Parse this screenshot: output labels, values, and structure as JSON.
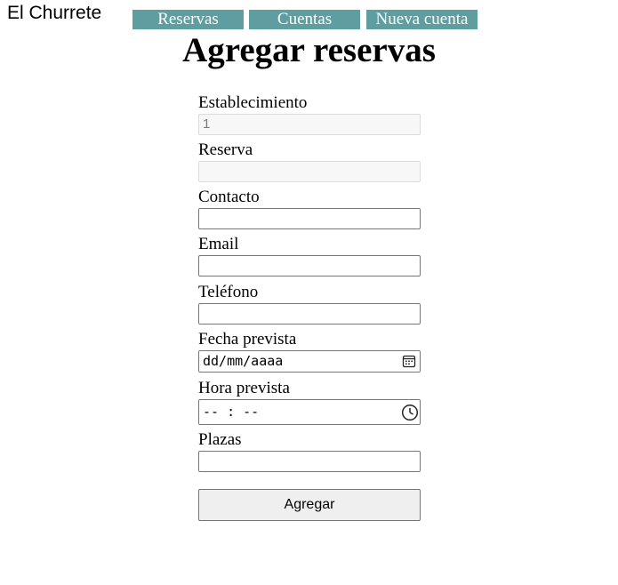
{
  "brand": "El Churrete",
  "nav": {
    "reservas": "Reservas",
    "cuentas": "Cuentas",
    "nueva_cuenta": "Nueva cuenta"
  },
  "title": "Agregar reservas",
  "form": {
    "establecimiento": {
      "label": "Establecimiento",
      "value": "1"
    },
    "reserva": {
      "label": "Reserva",
      "value": ""
    },
    "contacto": {
      "label": "Contacto",
      "value": ""
    },
    "email": {
      "label": "Email",
      "value": ""
    },
    "telefono": {
      "label": "Teléfono",
      "value": ""
    },
    "fecha": {
      "label": "Fecha prevista",
      "placeholder": "dd/mm/aaaa",
      "icon": "calendar-icon"
    },
    "hora": {
      "label": "Hora prevista",
      "placeholder": "-- : --",
      "icon": "clock-icon"
    },
    "plazas": {
      "label": "Plazas",
      "value": ""
    },
    "submit": "Agregar"
  },
  "colors": {
    "nav_bg": "#5f9ea0",
    "nav_text": "#ffffff"
  }
}
